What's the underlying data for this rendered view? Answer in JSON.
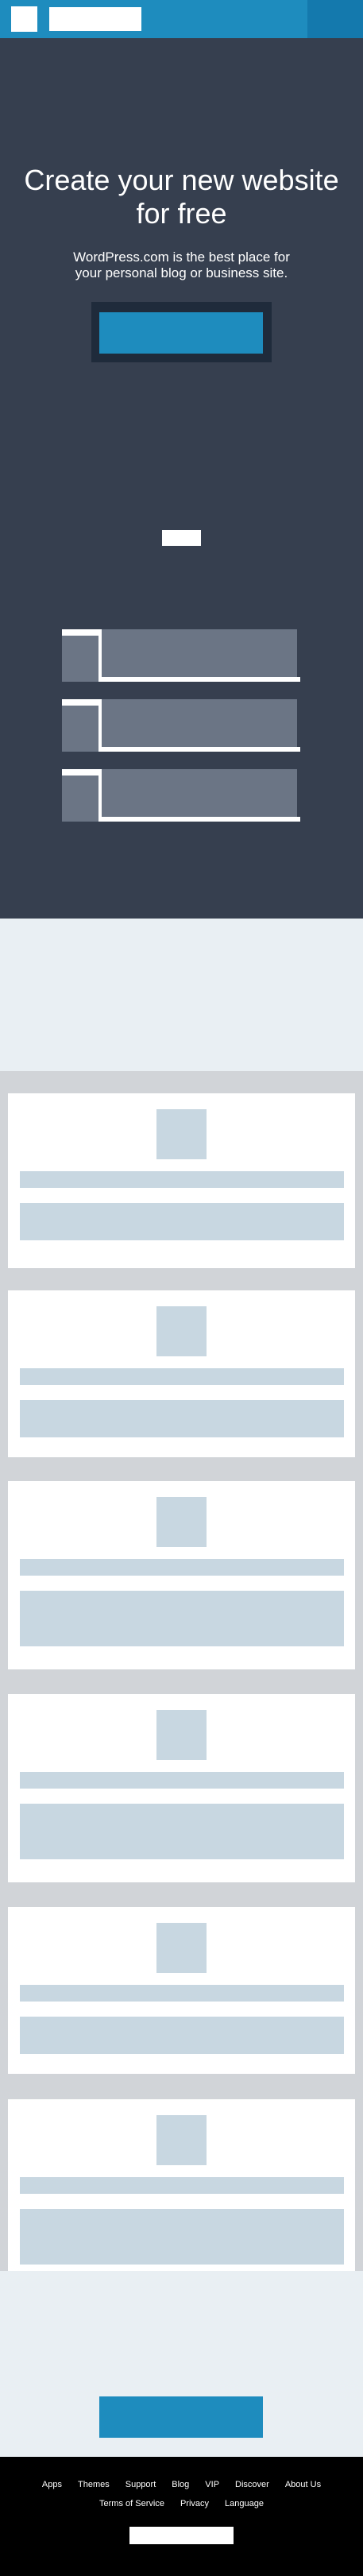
{
  "colors": {
    "brand_blue": "#1e8cbe",
    "hero_bg": "#363f4f",
    "placeholder": "#c8d7e1",
    "footer_bg": "#000000"
  },
  "masthead": {
    "logo_icon": "wordpress-logo-icon"
  },
  "hero": {
    "title": "Create your new website for free",
    "subtitle": "WordPress.com is the best place for your personal blog or business site."
  },
  "footer": {
    "links_row1": [
      "Apps",
      "Themes",
      "Support",
      "Blog",
      "VIP",
      "Discover",
      "About Us"
    ],
    "links_row2": [
      "Terms of Service",
      "Privacy",
      "Language"
    ]
  }
}
